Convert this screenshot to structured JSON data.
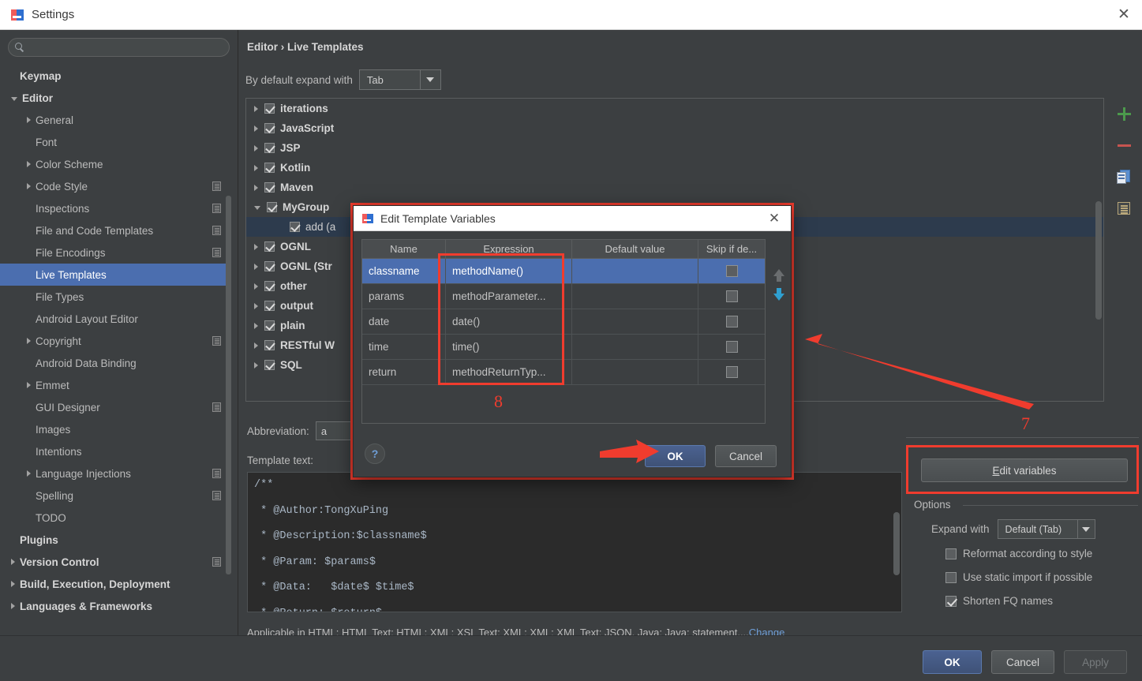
{
  "window": {
    "title": "Settings",
    "close_label": "✕"
  },
  "sidebar": {
    "search": {
      "value": "",
      "placeholder": ""
    },
    "items": [
      {
        "label": "Keymap",
        "arrow": "none",
        "bold": true,
        "gear": false,
        "selected": false
      },
      {
        "label": "Editor",
        "arrow": "down",
        "bold": true,
        "gear": false,
        "selected": false,
        "indent": 0
      },
      {
        "label": "General",
        "arrow": "right",
        "bold": false,
        "gear": false,
        "selected": false,
        "indent": 1
      },
      {
        "label": "Font",
        "arrow": "none",
        "bold": false,
        "gear": false,
        "selected": false,
        "indent": 1
      },
      {
        "label": "Color Scheme",
        "arrow": "right",
        "bold": false,
        "gear": false,
        "selected": false,
        "indent": 1
      },
      {
        "label": "Code Style",
        "arrow": "right",
        "bold": false,
        "gear": true,
        "selected": false,
        "indent": 1
      },
      {
        "label": "Inspections",
        "arrow": "none",
        "bold": false,
        "gear": true,
        "selected": false,
        "indent": 1
      },
      {
        "label": "File and Code Templates",
        "arrow": "none",
        "bold": false,
        "gear": true,
        "selected": false,
        "indent": 1
      },
      {
        "label": "File Encodings",
        "arrow": "none",
        "bold": false,
        "gear": true,
        "selected": false,
        "indent": 1
      },
      {
        "label": "Live Templates",
        "arrow": "none",
        "bold": false,
        "gear": false,
        "selected": true,
        "indent": 1
      },
      {
        "label": "File Types",
        "arrow": "none",
        "bold": false,
        "gear": false,
        "selected": false,
        "indent": 1
      },
      {
        "label": "Android Layout Editor",
        "arrow": "none",
        "bold": false,
        "gear": false,
        "selected": false,
        "indent": 1
      },
      {
        "label": "Copyright",
        "arrow": "right",
        "bold": false,
        "gear": true,
        "selected": false,
        "indent": 1
      },
      {
        "label": "Android Data Binding",
        "arrow": "none",
        "bold": false,
        "gear": false,
        "selected": false,
        "indent": 1
      },
      {
        "label": "Emmet",
        "arrow": "right",
        "bold": false,
        "gear": false,
        "selected": false,
        "indent": 1
      },
      {
        "label": "GUI Designer",
        "arrow": "none",
        "bold": false,
        "gear": true,
        "selected": false,
        "indent": 1
      },
      {
        "label": "Images",
        "arrow": "none",
        "bold": false,
        "gear": false,
        "selected": false,
        "indent": 1
      },
      {
        "label": "Intentions",
        "arrow": "none",
        "bold": false,
        "gear": false,
        "selected": false,
        "indent": 1
      },
      {
        "label": "Language Injections",
        "arrow": "right",
        "bold": false,
        "gear": true,
        "selected": false,
        "indent": 1
      },
      {
        "label": "Spelling",
        "arrow": "none",
        "bold": false,
        "gear": true,
        "selected": false,
        "indent": 1
      },
      {
        "label": "TODO",
        "arrow": "none",
        "bold": false,
        "gear": false,
        "selected": false,
        "indent": 1
      },
      {
        "label": "Plugins",
        "arrow": "none",
        "bold": true,
        "gear": false,
        "selected": false,
        "indent": 0
      },
      {
        "label": "Version Control",
        "arrow": "right",
        "bold": true,
        "gear": true,
        "selected": false,
        "indent": 0
      },
      {
        "label": "Build, Execution, Deployment",
        "arrow": "right",
        "bold": true,
        "gear": false,
        "selected": false,
        "indent": 0
      },
      {
        "label": "Languages & Frameworks",
        "arrow": "right",
        "bold": true,
        "gear": false,
        "selected": false,
        "indent": 0
      }
    ],
    "help_label": "?"
  },
  "main": {
    "breadcrumb": "Editor › Live Templates",
    "expand_label": "By default expand with",
    "expand_value": "Tab",
    "template_groups": [
      {
        "label": "iterations",
        "arrow": "right",
        "checked": true,
        "child": false
      },
      {
        "label": "JavaScript",
        "arrow": "right",
        "checked": true,
        "child": false
      },
      {
        "label": "JSP",
        "arrow": "right",
        "checked": true,
        "child": false
      },
      {
        "label": "Kotlin",
        "arrow": "right",
        "checked": true,
        "child": false
      },
      {
        "label": "Maven",
        "arrow": "right",
        "checked": true,
        "child": false
      },
      {
        "label": "MyGroup",
        "arrow": "down",
        "checked": true,
        "child": false
      },
      {
        "label": "add (a",
        "arrow": "hidden",
        "checked": true,
        "child": true,
        "selected": true
      },
      {
        "label": "OGNL",
        "arrow": "right",
        "checked": true,
        "child": false
      },
      {
        "label": "OGNL (Str",
        "arrow": "right",
        "checked": true,
        "child": false
      },
      {
        "label": "other",
        "arrow": "right",
        "checked": true,
        "child": false
      },
      {
        "label": "output",
        "arrow": "right",
        "checked": true,
        "child": false
      },
      {
        "label": "plain",
        "arrow": "right",
        "checked": true,
        "child": false
      },
      {
        "label": "RESTful W",
        "arrow": "right",
        "checked": true,
        "child": false
      },
      {
        "label": "SQL",
        "arrow": "right",
        "checked": true,
        "child": false
      }
    ],
    "toolbar_icons": [
      "add-icon",
      "remove-icon",
      "copy-icon",
      "duplicate-icon"
    ],
    "abbreviation_label": "Abbreviation:",
    "abbreviation_value": "a",
    "template_text_label": "Template text:",
    "template_code": [
      "/**",
      " * @Author:TongXuPing",
      " * @Description:$classname$",
      " * @Param: $params$",
      " * @Data:   $date$ $time$",
      " * @Return: $return$"
    ],
    "applicable_text": "Applicable in HTML: HTML Text; HTML; XML: XSL Text; XML; XML: XML Text; JSON, Java; Java: statement,...",
    "applicable_link": "Change"
  },
  "right_panel": {
    "edit_variables_label": "Edit variables",
    "edit_variables_mnemonic": "E",
    "annotation_7": "7",
    "options_title": "Options",
    "expand_with_label": "Expand with",
    "expand_with_value": "Default (Tab)",
    "checkboxes": [
      {
        "label": "Reformat according to style",
        "checked": false
      },
      {
        "label": "Use static import if possible",
        "checked": false
      },
      {
        "label": "Shorten FQ names",
        "checked": true
      }
    ]
  },
  "bottom_bar": {
    "ok": "OK",
    "cancel": "Cancel",
    "apply": "Apply"
  },
  "dialog": {
    "title": "Edit Template Variables",
    "close_label": "✕",
    "columns": [
      "Name",
      "Expression",
      "Default value",
      "Skip if de..."
    ],
    "rows": [
      {
        "name": "classname",
        "expression": "methodName()",
        "default": "",
        "skip": false,
        "selected": true
      },
      {
        "name": "params",
        "expression": "methodParameter...",
        "default": "",
        "skip": false,
        "selected": false
      },
      {
        "name": "date",
        "expression": "date()",
        "default": "",
        "skip": false,
        "selected": false
      },
      {
        "name": "time",
        "expression": "time()",
        "default": "",
        "skip": false,
        "selected": false
      },
      {
        "name": "return",
        "expression": "methodReturnTyp...",
        "default": "",
        "skip": false,
        "selected": false
      }
    ],
    "annotation_8": "8",
    "help_label": "?",
    "ok": "OK",
    "cancel": "Cancel"
  },
  "colors": {
    "accent_selection": "#4b6eaf",
    "annotation_red": "#f03c2e",
    "panel_bg": "#3c3f41",
    "editor_bg": "#2b2b2b",
    "add_green": "#4c9a4c",
    "remove_red": "#c75450",
    "link_blue": "#6f9fd8"
  }
}
